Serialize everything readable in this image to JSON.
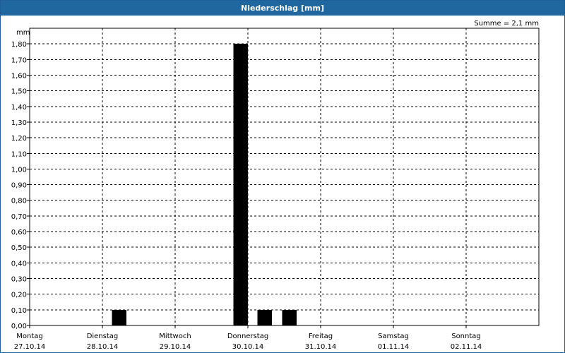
{
  "window": {
    "title": "Niederschlag [mm]"
  },
  "summary": {
    "text": "Summe = 2,1 mm"
  },
  "chart_data": {
    "type": "bar",
    "title": "Niederschlag [mm]",
    "ylabel": "mm",
    "xlabel": "",
    "ylim": [
      0,
      1.9
    ],
    "y_ticks": [
      "0,00",
      "0,10",
      "0,20",
      "0,30",
      "0,40",
      "0,50",
      "0,60",
      "0,70",
      "0,80",
      "0,90",
      "1,00",
      "1,10",
      "1,20",
      "1,30",
      "1,40",
      "1,50",
      "1,60",
      "1,70",
      "1,80"
    ],
    "y_tick_values": [
      0,
      0.1,
      0.2,
      0.3,
      0.4,
      0.5,
      0.6,
      0.7,
      0.8,
      0.9,
      1.0,
      1.1,
      1.2,
      1.3,
      1.4,
      1.5,
      1.6,
      1.7,
      1.8
    ],
    "x_range_days": [
      0,
      7
    ],
    "days": [
      {
        "weekday": "Montag",
        "date": "27.10.14"
      },
      {
        "weekday": "Dienstag",
        "date": "28.10.14"
      },
      {
        "weekday": "Mittwoch",
        "date": "29.10.14"
      },
      {
        "weekday": "Donnerstag",
        "date": "30.10.14"
      },
      {
        "weekday": "Freitag",
        "date": "31.10.14"
      },
      {
        "weekday": "Samstag",
        "date": "01.11.14"
      },
      {
        "weekday": "Sonntag",
        "date": "02.11.14"
      }
    ],
    "bars": [
      {
        "x": 1.13,
        "value": 0.1
      },
      {
        "x": 2.8,
        "value": 1.8
      },
      {
        "x": 3.13,
        "value": 0.1
      },
      {
        "x": 3.47,
        "value": 0.1
      }
    ],
    "bar_width_days": 0.2,
    "grid": true,
    "colors": {
      "bar": "#000000",
      "grid": "#000000",
      "titlebar": "#20669f"
    }
  }
}
